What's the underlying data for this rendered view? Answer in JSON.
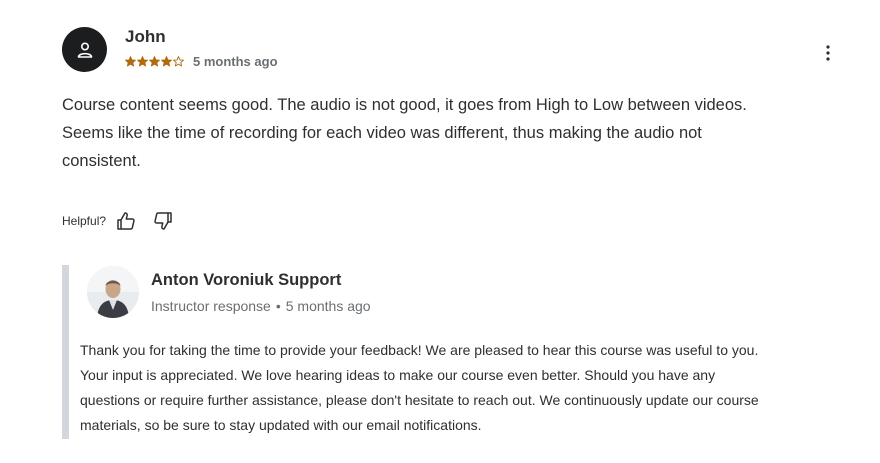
{
  "review": {
    "reviewer_initial_icon": "user-icon",
    "reviewer_name": "John",
    "rating": 4,
    "max_rating": 5,
    "time_ago": "5 months ago",
    "menu_icon": "more-vertical-icon",
    "text": "Course content seems good. The audio is not good, it goes from High to Low between videos. Seems like the time of recording for each video was different, thus making the audio not consistent.",
    "helpful_label": "Helpful?",
    "thumbs_up_icon": "thumbs-up-icon",
    "thumbs_down_icon": "thumbs-down-icon"
  },
  "response": {
    "responder_name": "Anton Voroniuk Support",
    "role_label": "Instructor response",
    "separator": "•",
    "time_ago": "5 months ago",
    "text": "Thank you for taking the time to provide your feedback! We are pleased to hear this course was useful to you. Your input is appreciated. We love hearing ideas to make our course even better. Should you have any questions or require further assistance, please don't hesitate to reach out. We continuously update our course materials, so be sure to stay updated with our email notifications."
  },
  "colors": {
    "star": "#b4690e",
    "avatar_bg": "#1c1d1f",
    "muted_text": "#6a6f73",
    "quote_border": "#d1d7dc"
  }
}
